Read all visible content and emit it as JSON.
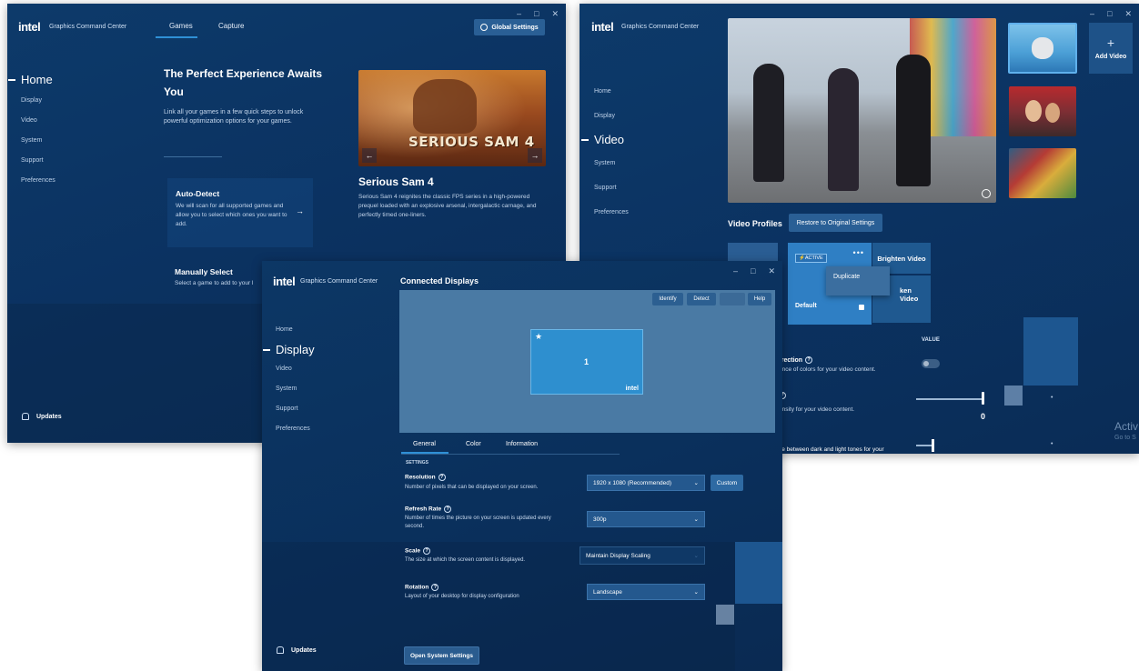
{
  "games_window": {
    "logo": "intel",
    "app_title": "Graphics Command Center",
    "tabs": [
      "Games",
      "Capture"
    ],
    "global_settings": "Global Settings",
    "nav": {
      "active": "Home",
      "items": [
        "Display",
        "Video",
        "System",
        "Support",
        "Preferences"
      ]
    },
    "hero_title": "The Perfect Experience Awaits You",
    "hero_desc": "Link all your games in a few quick steps to unlock powerful optimization options for your games.",
    "auto_detect": {
      "title": "Auto-Detect",
      "desc": "We will scan for all supported games and allow you to select which ones you want to add."
    },
    "manual_select": {
      "title": "Manually Select",
      "desc": "Select a game to add to your l"
    },
    "featured_game": {
      "banner_text": "SERIOUS SAM 4",
      "title": "Serious Sam 4",
      "desc": "Serious Sam 4 reignites the classic FPS series in a high-powered prequel loaded with an explosive arsenal, intergalactic carnage, and perfectly timed one-liners."
    },
    "updates": "Updates"
  },
  "video_window": {
    "logo": "intel",
    "app_title": "Graphics Command Center",
    "nav": {
      "items_before": [
        "Home",
        "Display"
      ],
      "active": "Video",
      "items_after": [
        "System",
        "Support",
        "Preferences"
      ]
    },
    "add_video": "Add Video",
    "video_profiles": "Video Profiles",
    "restore": "Restore to Original Settings",
    "active_badge": "ACTIVE",
    "profile_default": "Default",
    "context_menu": "Duplicate",
    "brighten_video": "Brighten Video",
    "sharpen_video": "ken Video",
    "value_header": "VALUE",
    "row1_title": "rrection",
    "row1_desc": "ance of colors for your video content.",
    "row2_desc": "ensity for your video content.",
    "row2_value": "0",
    "row3_desc": "ce between dark and light tones for your",
    "watermark_1": "Activ",
    "watermark_2": "Go to S"
  },
  "display_window": {
    "logo": "intel",
    "app_title": "Graphics Command Center",
    "nav": {
      "items_before": [
        "Home"
      ],
      "active": "Display",
      "items_after": [
        "Video",
        "System",
        "Support",
        "Preferences"
      ]
    },
    "heading": "Connected Displays",
    "buttons": [
      "Identify",
      "Detect",
      "Help"
    ],
    "monitor_number": "1",
    "monitor_brand": "intel",
    "tabs": [
      "General",
      "Color",
      "Information"
    ],
    "section": "SETTINGS",
    "settings": [
      {
        "title": "Resolution",
        "desc": "Number of pixels that can be displayed on your screen.",
        "value": "1920 x 1080 (Recommended)"
      },
      {
        "title": "Refresh Rate",
        "desc": "Number of times the picture on your screen is updated every second.",
        "value": "300p"
      },
      {
        "title": "Scale",
        "desc": "The size at which the screen content is displayed.",
        "value": "Maintain Display Scaling"
      },
      {
        "title": "Rotation",
        "desc": "Layout of your desktop for display configuration",
        "value": "Landscape"
      }
    ],
    "custom": "Custom",
    "open_system_settings": "Open System Settings",
    "updates": "Updates"
  }
}
